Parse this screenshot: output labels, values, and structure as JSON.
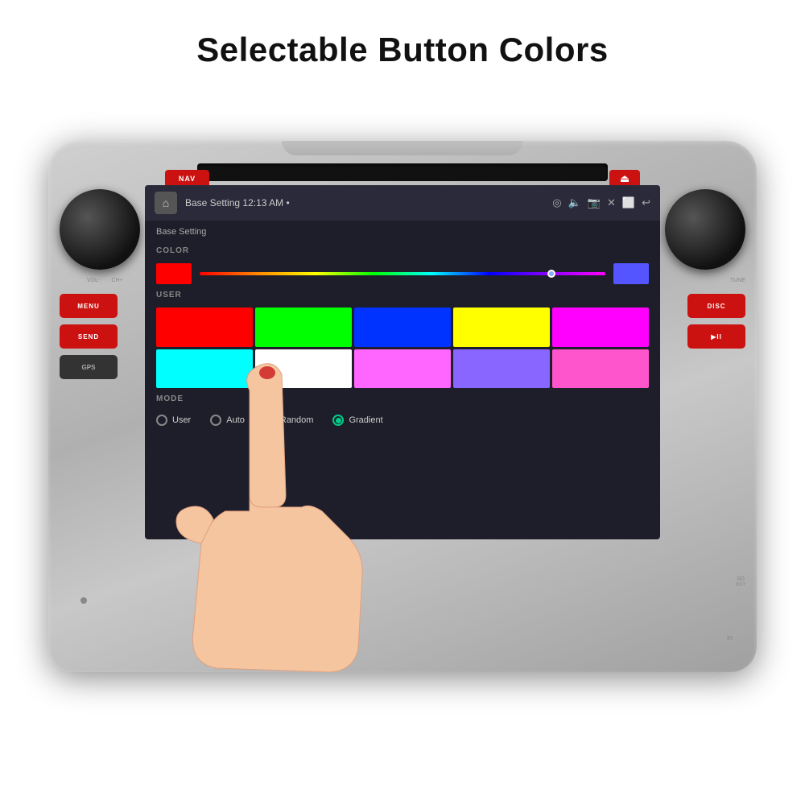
{
  "page": {
    "title": "Selectable Button Colors",
    "background": "#ffffff"
  },
  "status_bar": {
    "title": "Base Setting",
    "time": "12:13 AM",
    "dot": "•"
  },
  "base_setting": {
    "header": "Base Setting",
    "color_label": "COLOR",
    "user_label": "USER",
    "mode_label": "MODE"
  },
  "mode_options": [
    {
      "id": "user",
      "label": "User",
      "selected": false
    },
    {
      "id": "auto",
      "label": "Auto",
      "selected": false
    },
    {
      "id": "random",
      "label": "Random",
      "selected": false
    },
    {
      "id": "gradient",
      "label": "Gradient",
      "selected": true
    }
  ],
  "user_colors": [
    "#ff0000",
    "#00ff00",
    "#0000ff",
    "#ffff00",
    "#ff00ff",
    "#00ffff",
    "#ffffff",
    "#ff88ff",
    "#8888ff",
    "#ff88ff"
  ],
  "left_panel_buttons": [
    {
      "label": "MENU",
      "color": "red"
    },
    {
      "label": "SEND",
      "color": "red"
    },
    {
      "label": "GPS",
      "color": "dark"
    }
  ],
  "right_panel_buttons": [
    {
      "label": "DISC",
      "color": "red"
    },
    {
      "label": "▶II",
      "color": "red"
    }
  ],
  "top_buttons": {
    "nav": "NAV",
    "eject": "⏏"
  },
  "labels": {
    "vol_minus": "VOL-",
    "vol_plus": "CH+",
    "tune": "TUNE",
    "sd": "SD",
    "rst": "RST",
    "ir": "IR"
  }
}
